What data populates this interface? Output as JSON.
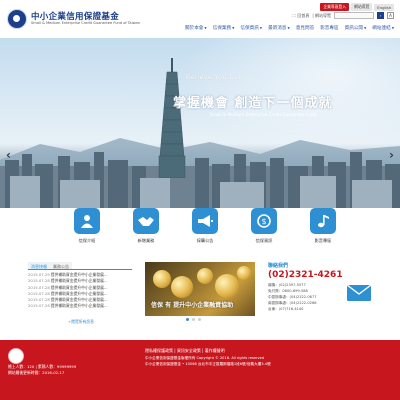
{
  "header": {
    "org_name": "中小企業信用保證基金",
    "org_name_en": "Small & Medium Enterprise Credit Guarantee Fund of Taiwan",
    "top_links": [
      {
        "label": "企業專區登入",
        "style": "red"
      },
      {
        "label": "網站導覽",
        "style": "gray"
      },
      {
        "label": "English",
        "style": "gray"
      }
    ],
    "search": {
      "prefix": "::: 回首頁",
      "sep": "| 網站導覽",
      "placeholder": "",
      "button": "›",
      "font_button": "A"
    },
    "nav": [
      "關於本會",
      "信保業務",
      "信保資訊",
      "最新消息",
      "意見問答",
      "影音專區",
      "資訊公開",
      "網站連結"
    ]
  },
  "banner": {
    "tagline_en": "Believe You Can",
    "headline": "掌握機會 創造下一個成就",
    "subtitle": "Small & Medium Enterprise Credit Guarantee Fund",
    "prev": "‹",
    "next": "›"
  },
  "quick_links": [
    {
      "label": "信保介紹",
      "icon": "person-icon"
    },
    {
      "label": "新增業務",
      "icon": "handshake-icon"
    },
    {
      "label": "採購公告",
      "icon": "megaphone-icon"
    },
    {
      "label": "信保資訊",
      "icon": "coins-icon"
    },
    {
      "label": "影音專區",
      "icon": "music-note-icon"
    }
  ],
  "news": {
    "tabs": [
      "消息快報",
      "業務公告"
    ],
    "items": [
      {
        "date": "2015.07.29",
        "title": "提供補助資金提升中小企業發展..."
      },
      {
        "date": "2015.07.28",
        "title": "提供補助資金提升中小企業發展..."
      },
      {
        "date": "2015.07.28",
        "title": "提供補助資金提升中小企業發展..."
      },
      {
        "date": "2015.07.28",
        "title": "提供補助資金提升中小企業發展..."
      },
      {
        "date": "2015.07.28",
        "title": "提供補助資金提升中小企業發展..."
      },
      {
        "date": "2015.07.28",
        "title": "提供補助資金提升中小企業發展..."
      }
    ],
    "more": "+閱覽所有訊息"
  },
  "feature": {
    "caption": "信保 有 提升中小企業融資協助"
  },
  "contact": {
    "title": "聯絡我們",
    "phone": "(02)2321-4261",
    "lines": [
      "總機：(02)2397-5577",
      "免付費：0800-699-588",
      "中區辦事處：(04)2322-0677",
      "南區辦事處：(04)2222-0268",
      "台東：(07)716-4140"
    ]
  },
  "footer": {
    "left_lines": [
      "總上人數：120 | 累積人數：99999999",
      "網站最後更新時間：2016-02-17"
    ],
    "links": "隱私權保護政策 | 資訊安全政策 | 著作權聲明",
    "right_lines": [
      "中小企業信用保證基金版權所有 Copyright © 2016. All rights reserved",
      "中小企業信用保證基金 • 10066 台北市中正區羅斯福路1段6號/信義大樓3-4號"
    ]
  },
  "colors": {
    "brand_blue": "#1d3f8a",
    "accent_blue": "#2e8fd3",
    "brand_red": "#c8161e"
  }
}
